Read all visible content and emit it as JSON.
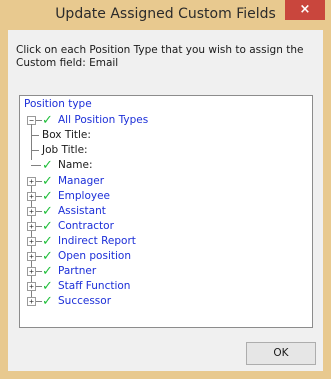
{
  "window": {
    "title": "Update Assigned Custom Fields",
    "close_glyph": "×"
  },
  "instructions": "Click on each Position Type that you wish to assign the Custom field: Email",
  "tree": {
    "root_label": "Position type",
    "all_types": {
      "label": "All Position Types",
      "checked": true,
      "expanded": true,
      "children": [
        {
          "label": "Box Title:",
          "checked": false
        },
        {
          "label": "Job Title:",
          "checked": false
        },
        {
          "label": "Name:",
          "checked": true
        }
      ]
    },
    "types": [
      {
        "label": "Manager",
        "checked": true
      },
      {
        "label": "Employee",
        "checked": true
      },
      {
        "label": "Assistant",
        "checked": true
      },
      {
        "label": "Contractor",
        "checked": true
      },
      {
        "label": "Indirect Report",
        "checked": true
      },
      {
        "label": "Open position",
        "checked": true
      },
      {
        "label": "Partner",
        "checked": true
      },
      {
        "label": "Staff Function",
        "checked": true
      },
      {
        "label": "Successor",
        "checked": true
      }
    ],
    "expand_glyph": "+",
    "collapse_glyph": "−",
    "check_glyph": "✓"
  },
  "buttons": {
    "ok": "OK"
  },
  "colors": {
    "frame": "#e8c98f",
    "close": "#c9463d",
    "link": "#1c2fd8",
    "check": "#1fbf3a"
  }
}
